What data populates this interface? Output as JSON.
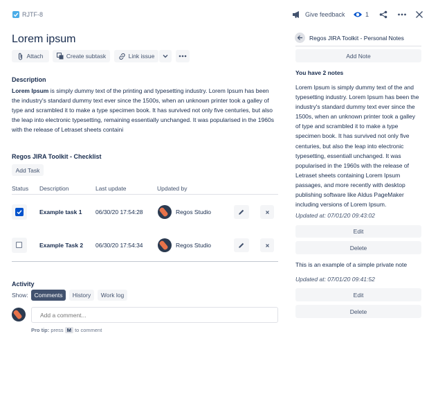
{
  "header": {
    "issue_key": "RJTF-8",
    "feedback_label": "Give feedback",
    "watch_count": "1"
  },
  "issue": {
    "title": "Lorem ipsum",
    "actions": {
      "attach": "Attach",
      "create_subtask": "Create subtask",
      "link_issue": "Link issue"
    },
    "description_heading": "Description",
    "description_bold": "Lorem Ipsum",
    "description_text": " is simply dummy text of the printing and typesetting industry. Lorem Ipsum has been the industry's standard dummy text ever since the 1500s, when an unknown printer took a galley of type and scrambled it to make a type specimen book. It has survived not only five centuries, but also the leap into electronic typesetting, remaining essentially unchanged. It was popularised in the 1960s with the release of Letraset sheets containi"
  },
  "checklist": {
    "heading": "Regos JIRA Toolkit - Checklist",
    "add_task": "Add Task",
    "columns": {
      "status": "Status",
      "description": "Description",
      "last_update": "Last update",
      "updated_by": "Updated by"
    },
    "rows": [
      {
        "description": "Example task 1",
        "last_update": "06/30/20 17:54:28",
        "updated_by": "Regos Studio",
        "checked": true
      },
      {
        "description": "Example Task 2",
        "last_update": "06/30/20 17:54:34",
        "updated_by": "Regos Studio",
        "checked": false
      }
    ]
  },
  "activity": {
    "heading": "Activity",
    "show_label": "Show:",
    "tabs": [
      "Comments",
      "History",
      "Work log"
    ],
    "comment_placeholder": "Add a comment...",
    "protip_prefix": "Pro tip:",
    "protip_mid": " press ",
    "protip_key": "M",
    "protip_suffix": " to comment"
  },
  "notes": {
    "panel_title": "Regos JIRA Toolkit - Personal Notes",
    "add_note": "Add Note",
    "count_heading": "You have 2 notes",
    "items": [
      {
        "text": "Lorem Ipsum is simply dummy text of the and typesetting industry. Lorem Ipsum has been the industry's standard dummy text ever since the 1500s, when an unknown printer took a galley of type and scrambled it to make a type specimen book. It has survived not only five centuries, but also the leap into electronic typesetting, essentiall unchanged. It was popularised in the 1960s with the release of Letraset sheets containing Lorem Ipsum passages, and more recently with desktop publishing software like Aldus PageMaker including versions of Lorem Ipsum.",
        "updated": "Updated at: 07/01/20 09:43:02",
        "edit": "Edit",
        "delete": "Delete"
      },
      {
        "text": "This is an example of a simple private note",
        "updated": "Updated at: 07/01/20 09:41:52",
        "edit": "Edit",
        "delete": "Delete"
      }
    ]
  },
  "colors": {
    "accent": "#0052cc",
    "button_bg": "#f4f5f7",
    "tab_active": "#42526e",
    "text": "#172b4d"
  }
}
